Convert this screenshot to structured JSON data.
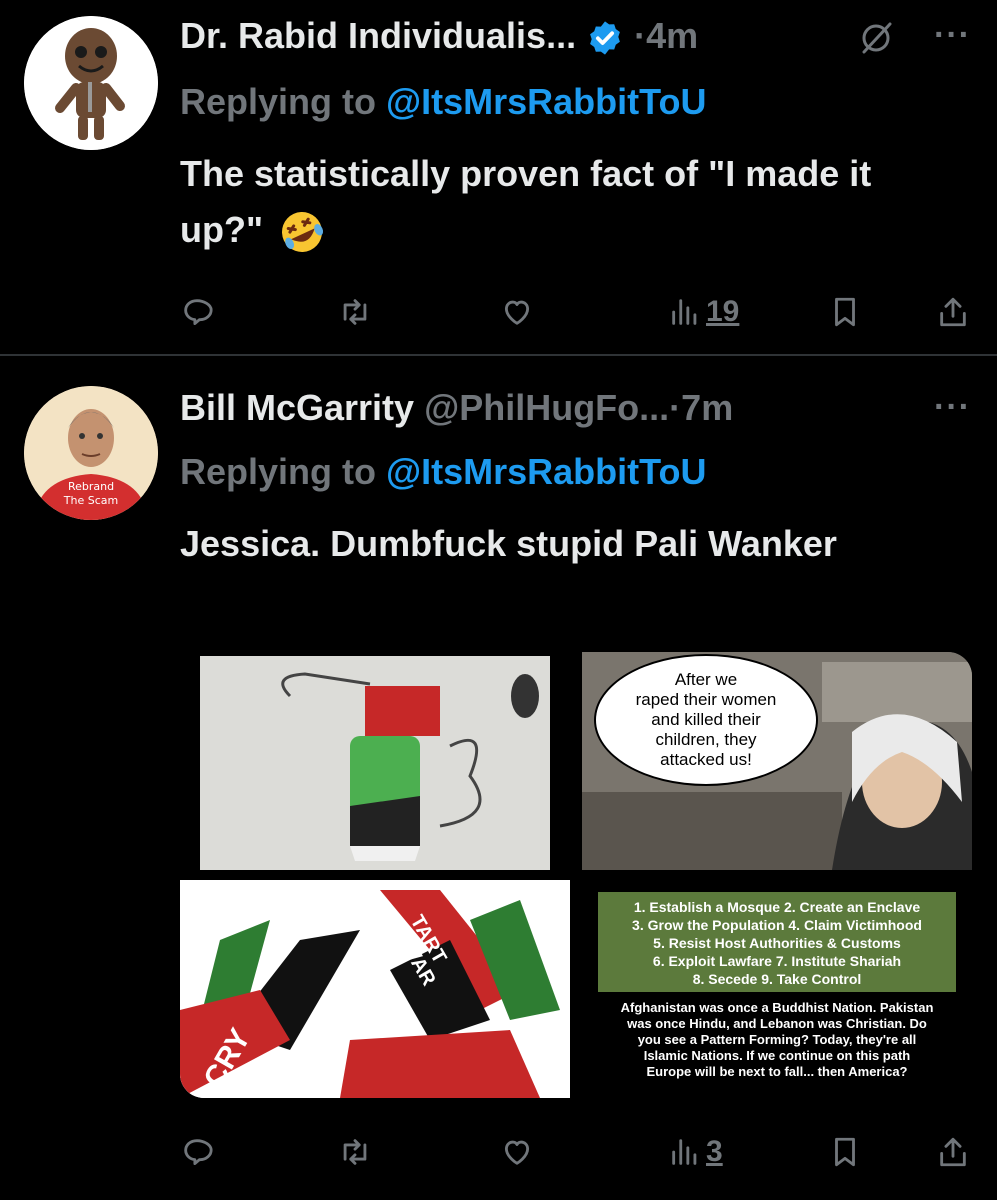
{
  "tweets": [
    {
      "author": "Dr. Rabid Individualis...",
      "time": "4m",
      "replying_prefix": "Replying to",
      "replying_handle": "@ItsMrsRabbitToU",
      "text": "The statistically proven fact of \"I made it up?\"",
      "emoji": "🤣",
      "views": "19"
    },
    {
      "author": "Bill McGarrity",
      "handle": "@PhilHugFo...",
      "time": "7m",
      "replying_prefix": "Replying to",
      "replying_handle": "@ItsMrsRabbitToU",
      "text": "Jessica. Dumbfuck stupid Pali Wanker",
      "views": "3",
      "avatar_shirt_text": [
        "Rebrand",
        "The Scam"
      ]
    }
  ],
  "media": {
    "speech_bubble": [
      "After we",
      "raped their women",
      "and killed their",
      "children, they",
      "attacked us!"
    ],
    "arrow_texts": [
      "TART",
      "A WAR",
      "CRY"
    ],
    "list_lines": [
      "1. Establish a Mosque    2. Create an Enclave",
      "3. Grow the Population    4. Claim Victimhood",
      "5. Resist Host Authorities & Customs",
      "6. Exploit Lawfare    7. Institute Shariah",
      "8. Secede    9. Take Control"
    ],
    "caption_lines": [
      "Afghanistan was once a Buddhist Nation. Pakistan",
      "was once Hindu, and Lebanon was Christian. Do",
      "you see a Pattern Forming? Today, they're all",
      "Islamic Nations. If we continue on this path",
      "Europe will be next to fall... then America?"
    ]
  },
  "icons": [
    "reply-icon",
    "retweet-icon",
    "like-icon",
    "views-icon",
    "bookmark-icon",
    "share-icon",
    "verified-icon",
    "grok-icon",
    "more-icon"
  ],
  "colors": {
    "background": "#000000",
    "text": "#e7e9ea",
    "muted": "#71767b",
    "accent": "#1d9bf0",
    "divider": "#2f3336"
  }
}
